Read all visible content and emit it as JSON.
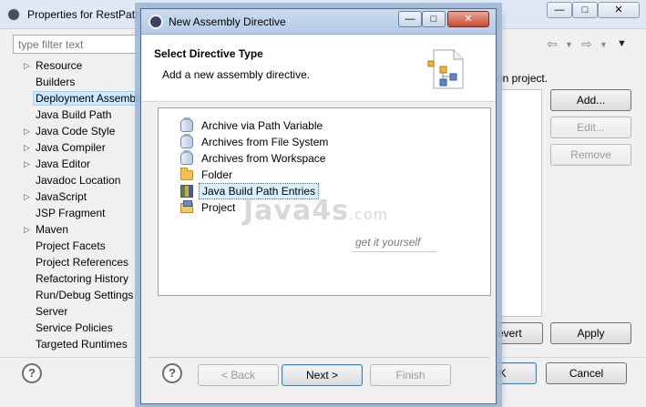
{
  "background": {
    "title": "Properties for RestPath",
    "filter_placeholder": "type filter text",
    "tree": [
      {
        "label": "Resource",
        "expandable": true
      },
      {
        "label": "Builders",
        "expandable": false
      },
      {
        "label": "Deployment Assembly",
        "expandable": false,
        "selected": true
      },
      {
        "label": "Java Build Path",
        "expandable": false
      },
      {
        "label": "Java Code Style",
        "expandable": true
      },
      {
        "label": "Java Compiler",
        "expandable": true
      },
      {
        "label": "Java Editor",
        "expandable": true
      },
      {
        "label": "Javadoc Location",
        "expandable": false
      },
      {
        "label": "JavaScript",
        "expandable": true
      },
      {
        "label": "JSP Fragment",
        "expandable": false
      },
      {
        "label": "Maven",
        "expandable": true
      },
      {
        "label": "Project Facets",
        "expandable": false
      },
      {
        "label": "Project References",
        "expandable": false
      },
      {
        "label": "Refactoring History",
        "expandable": false
      },
      {
        "label": "Run/Debug Settings",
        "expandable": false
      },
      {
        "label": "Server",
        "expandable": false
      },
      {
        "label": "Service Policies",
        "expandable": false
      },
      {
        "label": "Targeted Runtimes",
        "expandable": false
      }
    ],
    "desc_fragment": "on project.",
    "buttons": {
      "add": "Add...",
      "edit": "Edit...",
      "remove": "Remove",
      "revert": "evert",
      "apply": "Apply",
      "ok": "OK",
      "cancel": "Cancel"
    },
    "help": "?"
  },
  "dialog": {
    "title": "New Assembly Directive",
    "header_title": "Select Directive Type",
    "header_desc": "Add a new assembly directive.",
    "items": [
      {
        "label": "Archive via Path Variable",
        "icon": "jar-icon",
        "selected": false
      },
      {
        "label": "Archives from File System",
        "icon": "jar-icon",
        "selected": false
      },
      {
        "label": "Archives from Workspace",
        "icon": "jar-icon",
        "selected": false
      },
      {
        "label": "Folder",
        "icon": "folder-icon",
        "selected": false
      },
      {
        "label": "Java Build Path Entries",
        "icon": "library-icon",
        "selected": true
      },
      {
        "label": "Project",
        "icon": "project-icon",
        "selected": false
      }
    ],
    "watermark": {
      "logo_main": "Java4s",
      "logo_dot": ".com",
      "tagline": "get it yourself"
    },
    "buttons": {
      "back": "< Back",
      "next": "Next >",
      "finish": "Finish",
      "help": "?"
    }
  }
}
